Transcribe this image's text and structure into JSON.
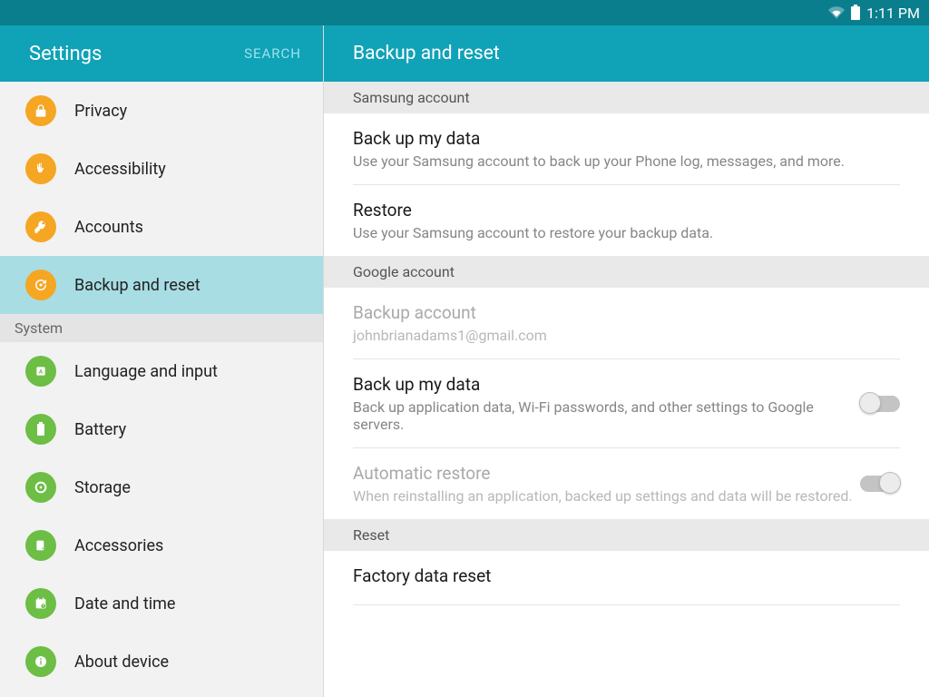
{
  "status": {
    "time": "1:11 PM"
  },
  "sidebar": {
    "title": "Settings",
    "search": "SEARCH",
    "items": [
      {
        "label": "Privacy",
        "color": "orange",
        "icon": "lock"
      },
      {
        "label": "Accessibility",
        "color": "orange",
        "icon": "hand"
      },
      {
        "label": "Accounts",
        "color": "orange",
        "icon": "key"
      },
      {
        "label": "Backup and reset",
        "color": "orange",
        "icon": "backup",
        "selected": true
      }
    ],
    "group_system": "System",
    "system": [
      {
        "label": "Language and input",
        "icon": "lang"
      },
      {
        "label": "Battery",
        "icon": "battery"
      },
      {
        "label": "Storage",
        "icon": "storage"
      },
      {
        "label": "Accessories",
        "icon": "accessories"
      },
      {
        "label": "Date and time",
        "icon": "date"
      },
      {
        "label": "About device",
        "icon": "info"
      }
    ]
  },
  "content": {
    "title": "Backup and reset",
    "sections": {
      "samsung": "Samsung account",
      "google": "Google account",
      "reset": "Reset"
    },
    "rows": {
      "sam_backup": {
        "title": "Back up my data",
        "sub": "Use your Samsung account to back up your Phone log, messages, and more."
      },
      "sam_restore": {
        "title": "Restore",
        "sub": "Use your Samsung account to restore your backup data."
      },
      "g_account": {
        "title": "Backup account",
        "sub": "johnbrianadams1@gmail.com"
      },
      "g_backup": {
        "title": "Back up my data",
        "sub": "Back up application data, Wi-Fi passwords, and other settings to Google servers."
      },
      "g_restore": {
        "title": "Automatic restore",
        "sub": "When reinstalling an application, backed up settings and data will be restored."
      },
      "factory": {
        "title": "Factory data reset"
      }
    }
  }
}
